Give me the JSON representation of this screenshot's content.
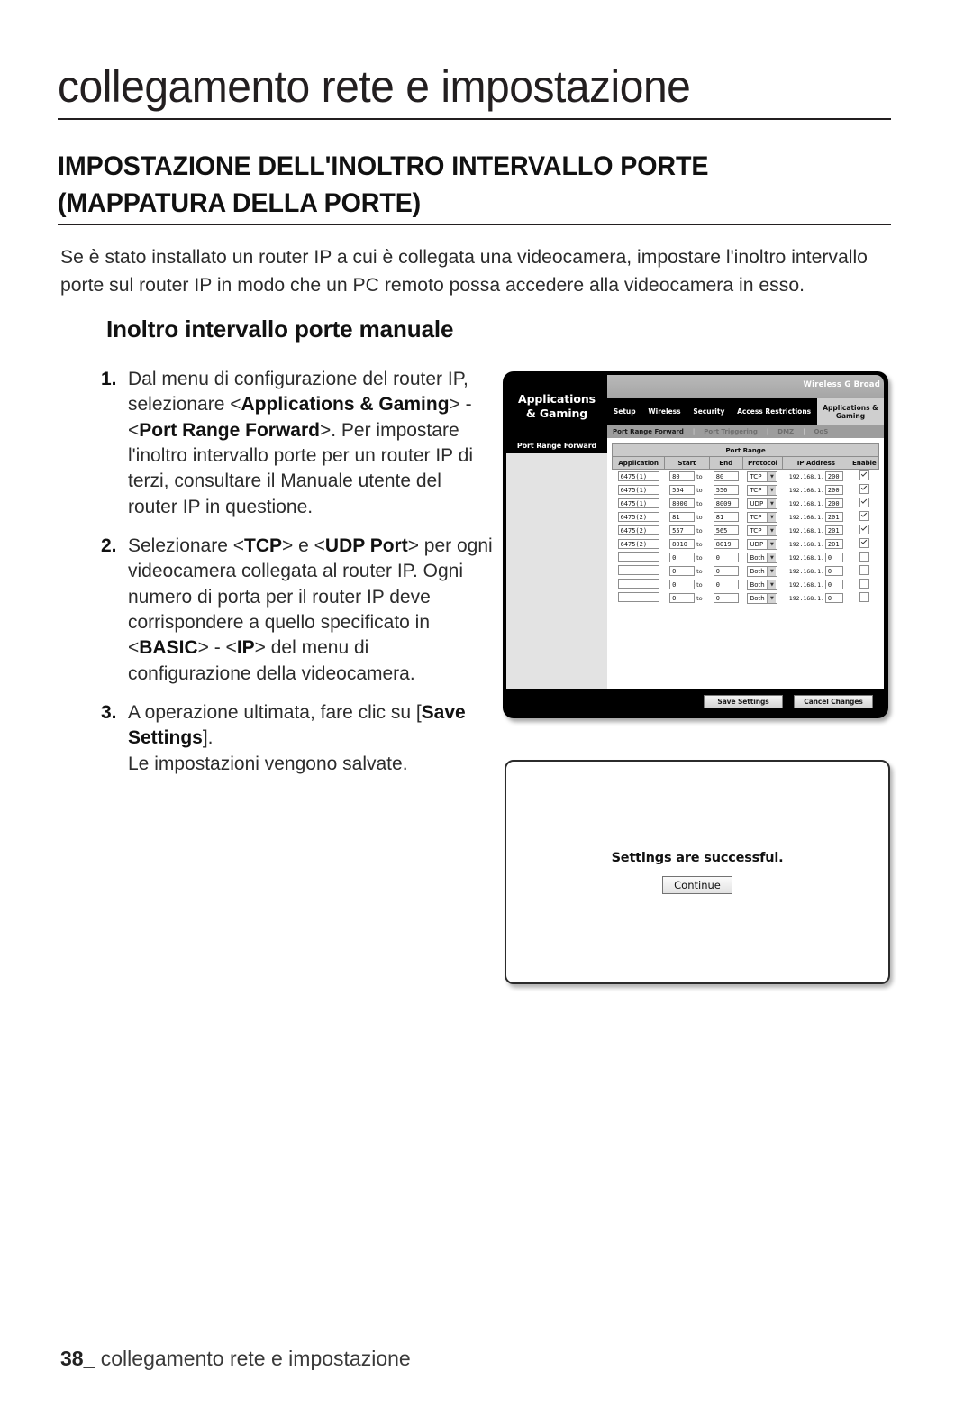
{
  "page": {
    "title": "collegamento rete e impostazione",
    "section_heading": "IMPOSTAZIONE DELL'INOLTRO INTERVALLO PORTE (MAPPATURA DELLA PORTE)",
    "intro": "Se è stato installato un router IP a cui è collegata una videocamera, impostare l'inoltro intervallo porte sul router IP in modo che un PC remoto possa accedere alla videocamera in esso.",
    "sub_heading": "Inoltro intervallo porte manuale",
    "footer_page_number": "38_",
    "footer_text": "collegamento rete e impostazione"
  },
  "steps": [
    {
      "number": "1.",
      "html": "Dal menu di configurazione del router IP, selezionare &lt;<b>Applications &amp; Gaming</b>&gt; - &lt;<b>Port Range Forward</b>&gt;. Per impostare l'inoltro intervallo porte per un router IP di terzi, consultare il Manuale utente del router IP in questione."
    },
    {
      "number": "2.",
      "html": "Selezionare &lt;<b>TCP</b>&gt; e &lt;<b>UDP Port</b>&gt; per ogni videocamera collegata al router IP. Ogni numero di porta per il router IP deve corrispondere a quello specificato in &lt;<b>BASIC</b>&gt; - &lt;<b>IP</b>&gt; del menu di configurazione della videocamera."
    },
    {
      "number": "3.",
      "html": "A operazione ultimata, fare clic su [<b>Save Settings</b>].<br>Le impostazioni vengono salvate."
    }
  ],
  "router": {
    "brand_text": "Wireless G Broad",
    "section_title_line1": "Applications",
    "section_title_line2": "& Gaming",
    "tabs": [
      {
        "label": "Setup",
        "active": false
      },
      {
        "label": "Wireless",
        "active": false
      },
      {
        "label": "Security",
        "active": false
      },
      {
        "label": "Access Restrictions",
        "active": false
      },
      {
        "label": "Applications & Gaming",
        "active": true
      }
    ],
    "subtabs": [
      {
        "label": "Port Range Forward",
        "current": true
      },
      {
        "label": "Port Triggering",
        "current": false
      },
      {
        "label": "DMZ",
        "current": false
      },
      {
        "label": "QoS",
        "current": false
      }
    ],
    "left_nav_title": "Port Range Forward",
    "table": {
      "group_header": "Port Range",
      "columns": [
        "Application",
        "Start",
        "End",
        "Protocol",
        "IP Address",
        "Enable"
      ],
      "to_label": "to",
      "ip_prefix": "192.168.1.",
      "rows": [
        {
          "application": "6475(1)",
          "start": "80",
          "end": "80",
          "protocol": "TCP",
          "ip_last": "200",
          "enable": true
        },
        {
          "application": "6475(1)",
          "start": "554",
          "end": "556",
          "protocol": "TCP",
          "ip_last": "200",
          "enable": true
        },
        {
          "application": "6475(1)",
          "start": "8000",
          "end": "8009",
          "protocol": "UDP",
          "ip_last": "200",
          "enable": true
        },
        {
          "application": "6475(2)",
          "start": "81",
          "end": "81",
          "protocol": "TCP",
          "ip_last": "201",
          "enable": true
        },
        {
          "application": "6475(2)",
          "start": "557",
          "end": "565",
          "protocol": "TCP",
          "ip_last": "201",
          "enable": true
        },
        {
          "application": "6475(2)",
          "start": "8010",
          "end": "8019",
          "protocol": "UDP",
          "ip_last": "201",
          "enable": true
        },
        {
          "application": "",
          "start": "0",
          "end": "0",
          "protocol": "Both",
          "ip_last": "0",
          "enable": false
        },
        {
          "application": "",
          "start": "0",
          "end": "0",
          "protocol": "Both",
          "ip_last": "0",
          "enable": false
        },
        {
          "application": "",
          "start": "0",
          "end": "0",
          "protocol": "Both",
          "ip_last": "0",
          "enable": false
        },
        {
          "application": "",
          "start": "0",
          "end": "0",
          "protocol": "Both",
          "ip_last": "0",
          "enable": false
        }
      ]
    },
    "save_button": "Save Settings",
    "cancel_button": "Cancel Changes"
  },
  "dialog": {
    "message": "Settings are successful.",
    "continue_button": "Continue"
  }
}
